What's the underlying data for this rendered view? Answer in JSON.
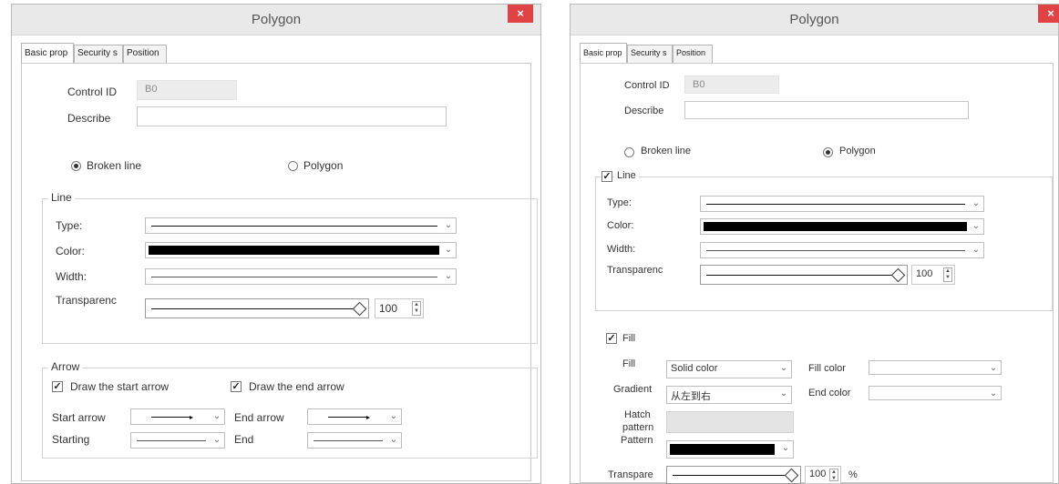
{
  "left": {
    "title": "Polygon",
    "close": "×",
    "tabs": [
      "Basic prop",
      "Security s",
      "Position"
    ],
    "control_id_label": "Control ID",
    "control_id_value": "B0",
    "describe_label": "Describe",
    "describe_value": "",
    "radio_broken": "Broken line",
    "radio_polygon": "Polygon",
    "selected_mode": "Broken line",
    "line_group": "Line",
    "type_label": "Type:",
    "color_label": "Color:",
    "width_label": "Width:",
    "transparency_label": "Transparenc",
    "transparency_value": "100",
    "arrow_group": "Arrow",
    "draw_start": "Draw the start arrow",
    "draw_end": "Draw the end arrow",
    "start_arrow_label": "Start arrow",
    "end_arrow_label": "End arrow",
    "starting_label": "Starting",
    "end_label": "End"
  },
  "right": {
    "title": "Polygon",
    "close": "×",
    "tabs": [
      "Basic prop",
      "Security s",
      "Position"
    ],
    "control_id_label": "Control ID",
    "control_id_value": "B0",
    "describe_label": "Describe",
    "describe_value": "",
    "radio_broken": "Broken line",
    "radio_polygon": "Polygon",
    "selected_mode": "Polygon",
    "line_group": "Line",
    "line_checked": true,
    "type_label": "Type:",
    "color_label": "Color:",
    "width_label": "Width:",
    "transparency_label": "Transparenc",
    "transparency_value": "100",
    "fill_group": "Fill",
    "fill_checked": true,
    "fill_label": "Fill",
    "fill_value": "Solid color",
    "fill_color_label": "Fill color",
    "gradient_label": "Gradient",
    "gradient_value": "从左到右",
    "end_color_label": "End color",
    "hatch_label_1": "Hatch",
    "hatch_label_2": "pattern",
    "pattern_label": "Pattern",
    "transpare_label": "Transpare",
    "transpare_value": "100",
    "percent": "%"
  },
  "colors": {
    "close_bg": "#e04343",
    "titlebar_bg": "#e9e9e9"
  }
}
